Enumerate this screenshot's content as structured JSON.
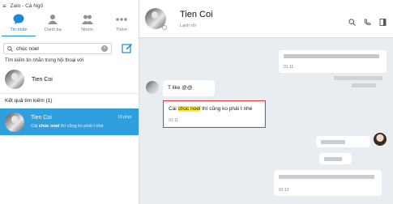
{
  "app": {
    "title": "Zalo - Cá Ngố"
  },
  "nav": [
    {
      "label": "Tin nhắn",
      "icon": "chat-icon"
    },
    {
      "label": "Danh bạ",
      "icon": "contacts-icon"
    },
    {
      "label": "Nhóm",
      "icon": "group-icon"
    },
    {
      "label": "Thêm",
      "icon": "more-icon"
    }
  ],
  "search": {
    "value": "chúc noel",
    "hint": "Tìm kiếm tin nhắn trong hội thoại với"
  },
  "contact": {
    "name": "Tien Coi"
  },
  "results": {
    "header": "Kết quả tìm kiếm (1)",
    "items": [
      {
        "name": "Tien Coi",
        "time": "19 phút",
        "pre": "Cái ",
        "highlight": "chúc noel",
        "post": " thì cũng ko phải t nhé"
      }
    ]
  },
  "chat": {
    "name": "Tien Coi",
    "status": "Lạnh rồi",
    "messages": {
      "m1": {
        "time": "01:11"
      },
      "m2": {
        "text": "T like @@"
      },
      "m3": {
        "pre": "Cái ",
        "highlight": "chúc noel",
        "post": " thì cũng ko phải t nhé",
        "time": "01:11"
      },
      "m4": {
        "time": "01:12"
      }
    }
  },
  "colors": {
    "accent": "#2f9fde",
    "highlight": "#ffeb3b",
    "red_box": "#e53935"
  }
}
